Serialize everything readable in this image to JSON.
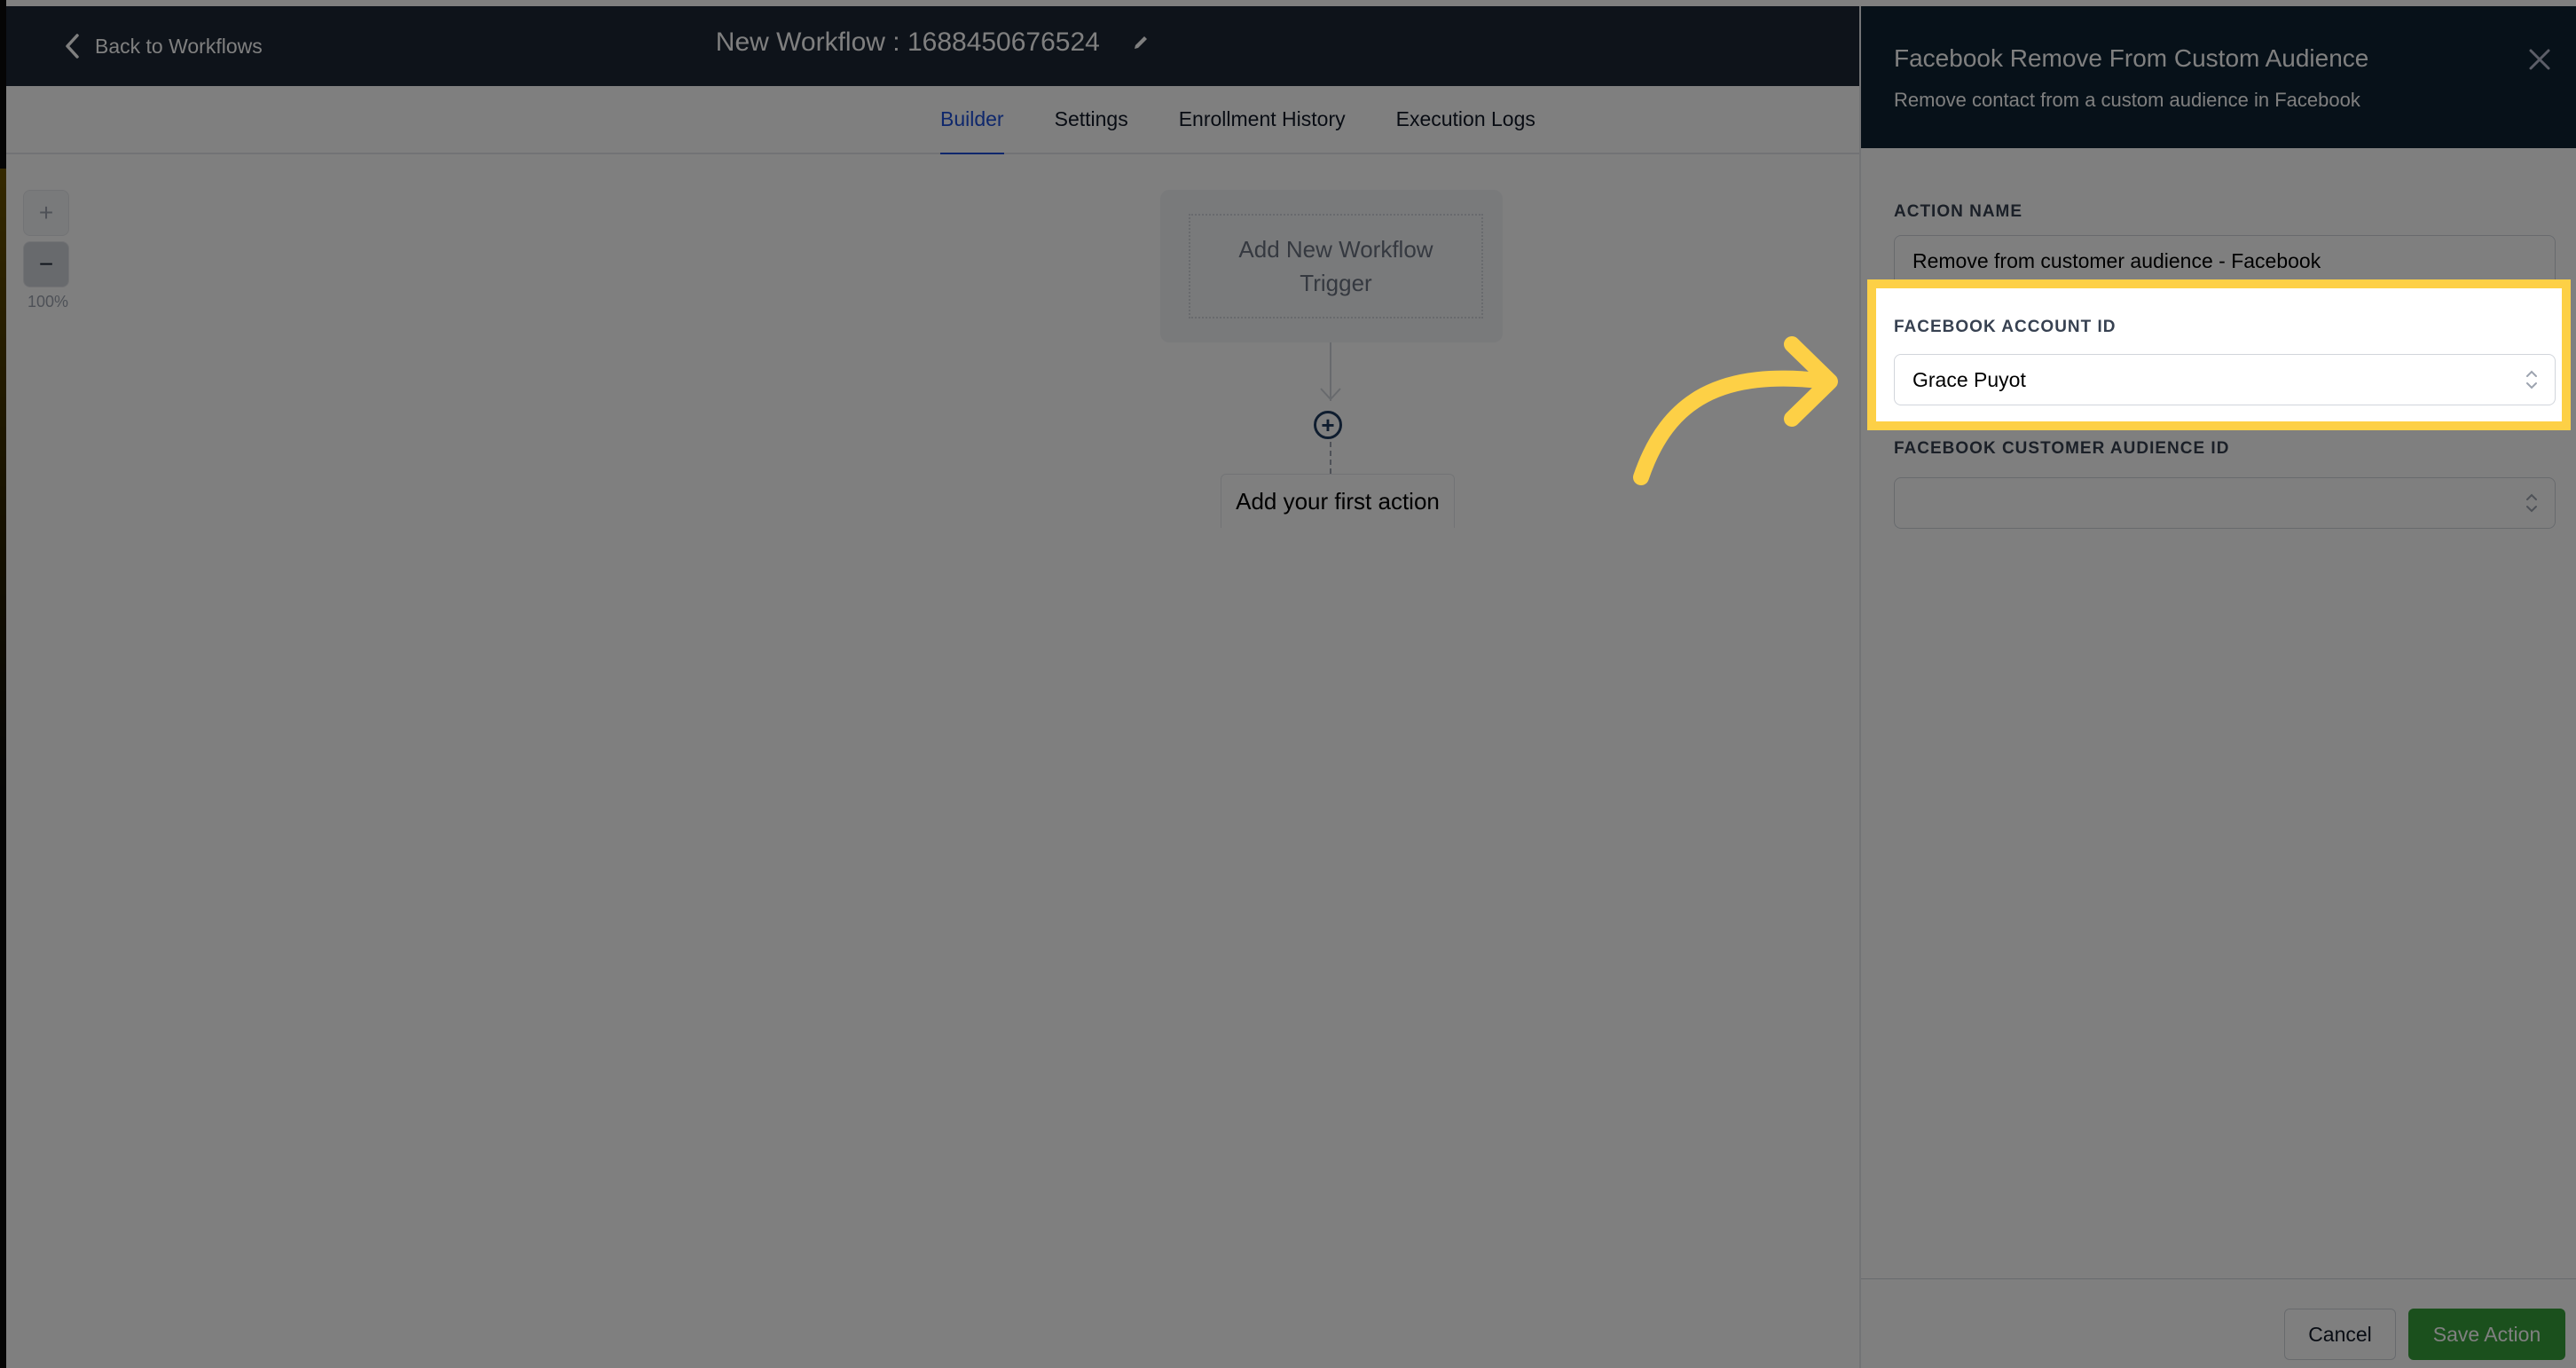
{
  "header": {
    "back_label": "Back to Workflows",
    "workflow_title": "New Workflow : 1688450676524"
  },
  "tabs": [
    {
      "label": "Builder",
      "active": true
    },
    {
      "label": "Settings",
      "active": false
    },
    {
      "label": "Enrollment History",
      "active": false
    },
    {
      "label": "Execution Logs",
      "active": false
    }
  ],
  "canvas": {
    "zoom_in_label": "+",
    "zoom_out_label": "−",
    "zoom_level": "100%",
    "trigger_label": "Add New Workflow Trigger",
    "add_action_icon": "plus-circle-icon",
    "first_action_label": "Add your first action"
  },
  "panel": {
    "title": "Facebook Remove From Custom Audience",
    "subtitle": "Remove contact from a custom audience in Facebook",
    "fields": [
      {
        "label": "ACTION NAME",
        "value": "Remove from customer audience - Facebook",
        "type": "text"
      },
      {
        "label": "FACEBOOK ACCOUNT ID",
        "value": "Grace Puyot",
        "type": "select"
      },
      {
        "label": "FACEBOOK CUSTOMER AUDIENCE ID",
        "value": "",
        "type": "select"
      }
    ],
    "cancel_label": "Cancel",
    "save_label": "Save Action"
  },
  "annotation": {
    "highlight_color": "#fdd046",
    "highlighted_field": "FACEBOOK ACCOUNT ID"
  },
  "colors": {
    "accent": "#1d4ed8",
    "save_green": "#37a13a",
    "header_dark": "#1d2634",
    "panel_header": "#0f2233"
  }
}
